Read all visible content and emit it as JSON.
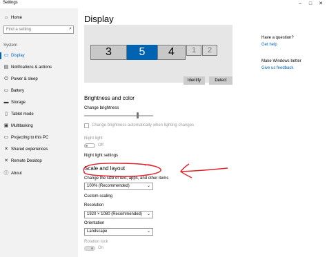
{
  "window": {
    "title": "Settings"
  },
  "sidebar": {
    "home_label": "Home",
    "search_placeholder": "Find a setting",
    "section_label": "System",
    "items": [
      {
        "label": "Display",
        "icon": "monitor-icon"
      },
      {
        "label": "Notifications & actions",
        "icon": "notifications-icon"
      },
      {
        "label": "Power & sleep",
        "icon": "power-icon"
      },
      {
        "label": "Battery",
        "icon": "battery-icon"
      },
      {
        "label": "Storage",
        "icon": "storage-icon"
      },
      {
        "label": "Tablet mode",
        "icon": "tablet-icon"
      },
      {
        "label": "Multitasking",
        "icon": "multitasking-icon"
      },
      {
        "label": "Projecting to this PC",
        "icon": "projecting-icon"
      },
      {
        "label": "Shared experiences",
        "icon": "shared-icon"
      },
      {
        "label": "Remote Desktop",
        "icon": "remote-desktop-icon"
      },
      {
        "label": "About",
        "icon": "info-icon"
      }
    ]
  },
  "main": {
    "title": "Display",
    "monitors": [
      "3",
      "5",
      "4",
      "1",
      "2"
    ],
    "identify_label": "Identify",
    "detect_label": "Detect",
    "brightness_heading": "Brightness and color",
    "change_brightness_label": "Change brightness",
    "auto_brightness_label": "Change brightness automatically when lighting changes",
    "night_light_label": "Night light",
    "night_light_state": "Off",
    "night_light_settings_link": "Night light settings",
    "scale_heading": "Scale and layout",
    "text_size_label": "Change the size of text, apps, and other items",
    "text_size_value": "100% (Recommended)",
    "custom_scaling_link": "Custom scaling",
    "resolution_label": "Resolution",
    "resolution_value": "1920 × 1080 (Recommended)",
    "orientation_label": "Orientation",
    "orientation_value": "Landscape",
    "rotation_lock_label": "Rotation lock",
    "rotation_lock_state": "On"
  },
  "help": {
    "question": "Have a question?",
    "get_help_link": "Get help",
    "better_label": "Make Windows better",
    "feedback_link": "Give us feedback"
  },
  "colors": {
    "accent": "#0063b1",
    "annotation": "#e0202a"
  }
}
